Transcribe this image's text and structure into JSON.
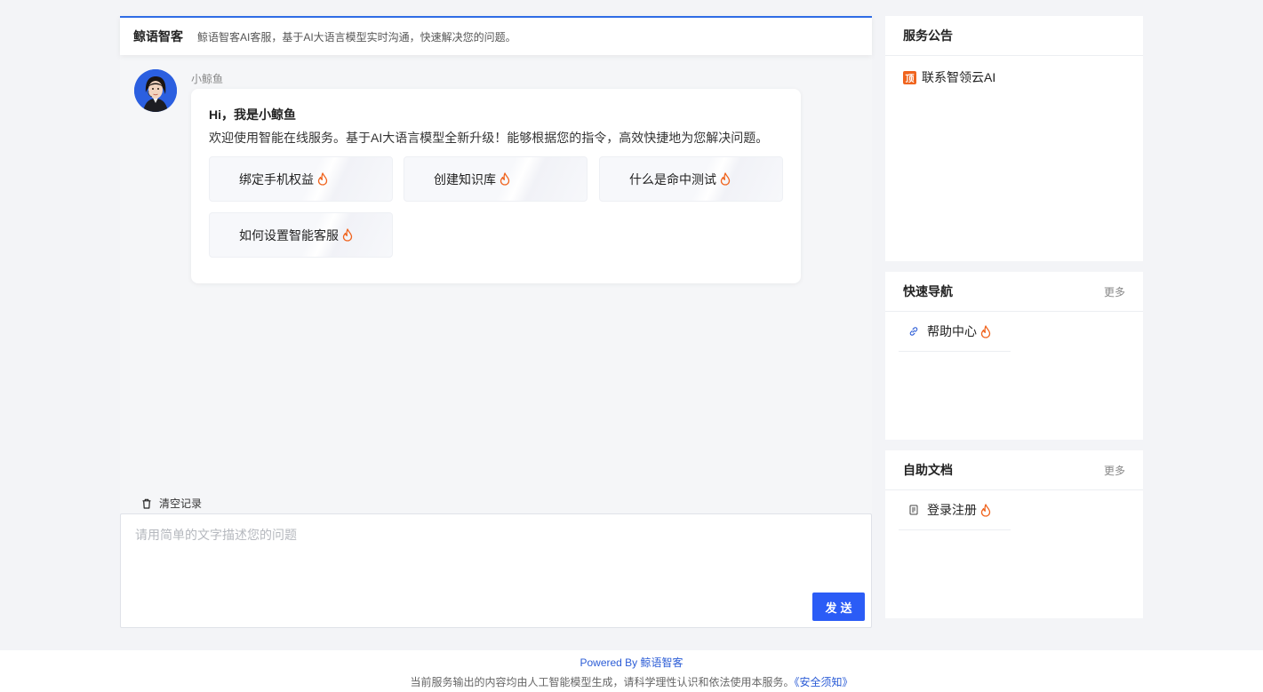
{
  "header": {
    "brand": "鲸语智客",
    "description": "鲸语智客AI客服，基于AI大语言模型实时沟通，快速解决您的问题。"
  },
  "chat": {
    "bot_name": "小鲸鱼",
    "greeting": "Hi，我是小鲸鱼",
    "intro": "欢迎使用智能在线服务。基于AI大语言模型全新升级！能够根据您的指令，高效快捷地为您解决问题。",
    "quick_questions": [
      "绑定手机权益",
      "创建知识库",
      "什么是命中测试",
      "如何设置智能客服"
    ],
    "clear_label": "清空记录",
    "input_placeholder": "请用简单的文字描述您的问题",
    "send_label": "发送"
  },
  "announcements": {
    "title": "服务公告",
    "items": [
      {
        "badge": "顶",
        "label": "联系智领云AI"
      }
    ]
  },
  "quick_nav": {
    "title": "快速导航",
    "more_label": "更多",
    "items": [
      {
        "label": "帮助中心",
        "icon": "link-icon"
      }
    ]
  },
  "self_help": {
    "title": "自助文档",
    "more_label": "更多",
    "items": [
      {
        "label": "登录注册",
        "icon": "document-icon"
      }
    ]
  },
  "footer": {
    "powered_prefix": "Powered By",
    "powered_brand": "鲸语智客",
    "notice": "当前服务输出的内容均由人工智能模型生成，请科学理性认识和依法使用本服务。",
    "notice_link": "《安全须知》"
  },
  "colors": {
    "accent": "#2b5cf6",
    "hot": "#f0641e",
    "background": "#f3f4f7"
  }
}
